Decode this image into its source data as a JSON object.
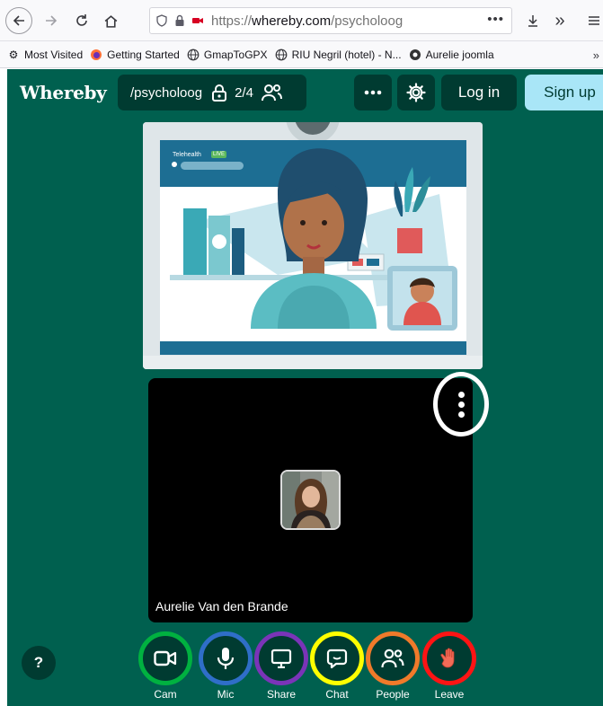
{
  "browser": {
    "url_prefix": "https://",
    "url_host": "whereby.com",
    "url_path": "/psycholoog",
    "url_menu": "•••",
    "bookmarks": [
      {
        "label": "Most Visited",
        "icon": "gear-icon"
      },
      {
        "label": "Getting Started",
        "icon": "firefox-icon"
      },
      {
        "label": "GmapToGPX",
        "icon": "globe-icon"
      },
      {
        "label": "RIU Negril (hotel) - N...",
        "icon": "globe-icon"
      },
      {
        "label": "Aurelie joomla",
        "icon": "joomla-icon"
      }
    ],
    "more_label": "»"
  },
  "app": {
    "brand": "Whereby",
    "room": {
      "name": "/psycholoog",
      "count": "2/4"
    },
    "login_label": "Log in",
    "signup_label": "Sign up",
    "help_label": "?",
    "illustration": {
      "badge_text": "Telehealth",
      "live_label": "LIVE"
    },
    "participant": {
      "name": "Aurelie Van den Brande"
    },
    "controls": [
      {
        "label": "Cam",
        "icon": "camera-icon",
        "ring": "#00b140"
      },
      {
        "label": "Mic",
        "icon": "mic-icon",
        "ring": "#2f6ec8"
      },
      {
        "label": "Share",
        "icon": "screen-share-icon",
        "ring": "#7a34b8"
      },
      {
        "label": "Chat",
        "icon": "chat-icon",
        "ring": "#ffff00"
      },
      {
        "label": "People",
        "icon": "people-icon",
        "ring": "#f07a2a"
      },
      {
        "label": "Leave",
        "icon": "wave-hand-icon",
        "ring": "#ff1414"
      }
    ],
    "colors": {
      "background": "#00604f",
      "panel": "#003b31",
      "signup": "#a9e6f7",
      "leave_fill": "#f26b57"
    }
  }
}
